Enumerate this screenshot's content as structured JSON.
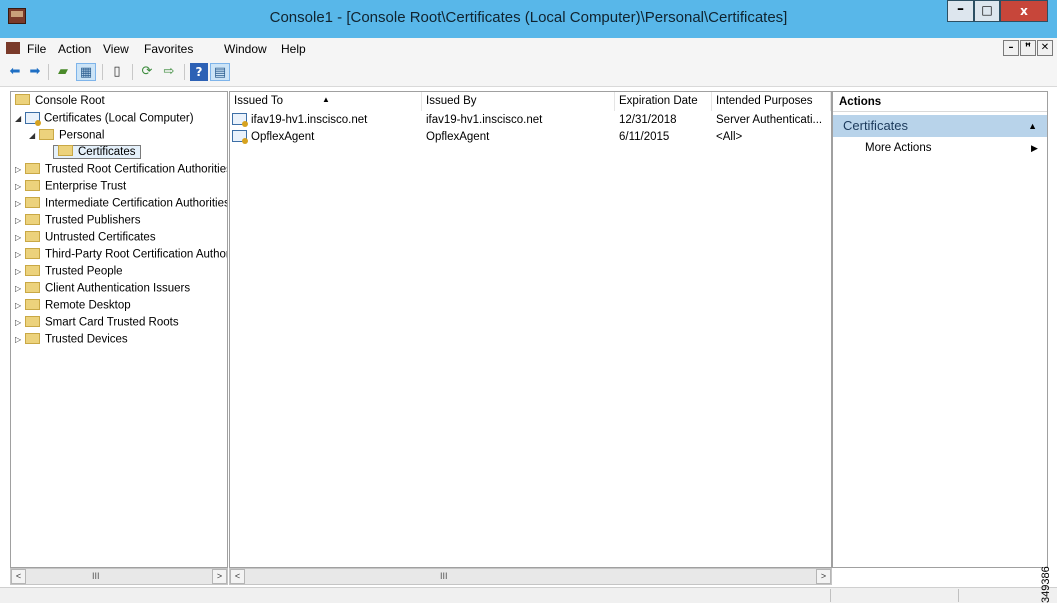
{
  "window": {
    "title": "Console1 - [Console Root\\Certificates (Local Computer)\\Personal\\Certificates]",
    "min_glyph": "–",
    "max_glyph": "□",
    "close_glyph": "x"
  },
  "menu": {
    "items": [
      "File",
      "Action",
      "View",
      "Favorites",
      "Window",
      "Help"
    ],
    "mdi": [
      "–",
      "ꟸ",
      "✕"
    ]
  },
  "tree": {
    "root": "Console Root",
    "computer": "Certificates (Local Computer)",
    "personal": "Personal",
    "certificates": "Certificates",
    "stores": [
      "Trusted Root Certification Authorities",
      "Enterprise Trust",
      "Intermediate Certification Authorities",
      "Trusted Publishers",
      "Untrusted Certificates",
      "Third-Party Root Certification Authorities",
      "Trusted People",
      "Client Authentication Issuers",
      "Remote Desktop",
      "Smart Card Trusted Roots",
      "Trusted Devices"
    ]
  },
  "list": {
    "columns": [
      "Issued To",
      "Issued By",
      "Expiration Date",
      "Intended Purposes"
    ],
    "rows": [
      {
        "issued_to": "ifav19-hv1.inscisco.net",
        "issued_by": "ifav19-hv1.inscisco.net",
        "expiration": "12/31/2018",
        "purposes": "Server Authenticati..."
      },
      {
        "issued_to": "OpflexAgent",
        "issued_by": "OpflexAgent",
        "expiration": "6/11/2015",
        "purposes": "<All>"
      }
    ]
  },
  "actions": {
    "header": "Actions",
    "section": "Certificates",
    "more": "More Actions"
  },
  "scrollbar": {
    "grip": "III",
    "left_arrow": "<",
    "right_arrow": ">"
  },
  "side_label": "349386",
  "colors": {
    "titlebar": "#58b7e9",
    "close": "#c7463a",
    "actions_section": "#b8d3ea",
    "folder": "#ecd27c"
  }
}
